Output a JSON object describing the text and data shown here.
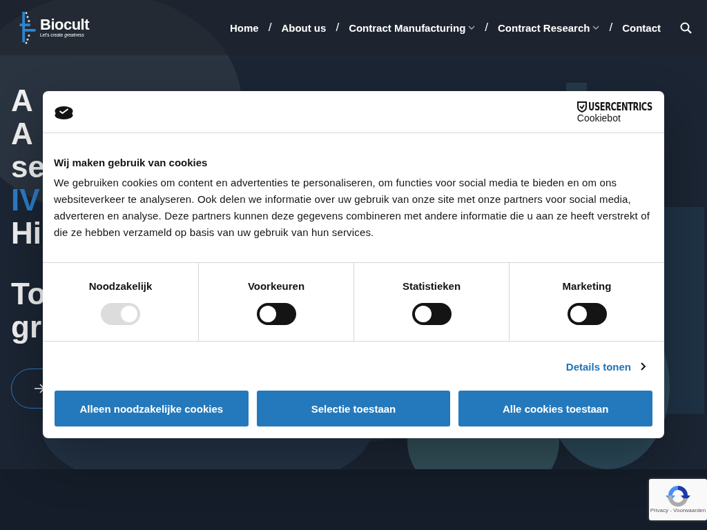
{
  "header": {
    "logo": {
      "name": "Biocult",
      "tagline": "Let's create *greatness*"
    },
    "nav": [
      {
        "kind": "link",
        "label": "Home",
        "dropdown": false
      },
      {
        "kind": "separator",
        "label": "/"
      },
      {
        "kind": "link",
        "label": "About us",
        "dropdown": false
      },
      {
        "kind": "separator",
        "label": "/"
      },
      {
        "kind": "link",
        "label": "Contract Manufacturing",
        "dropdown": true
      },
      {
        "kind": "separator",
        "label": "/"
      },
      {
        "kind": "link",
        "label": "Contract Research",
        "dropdown": true
      },
      {
        "kind": "separator",
        "label": "/"
      },
      {
        "kind": "link",
        "label": "Contact",
        "dropdown": false
      }
    ]
  },
  "hero": {
    "blocks": [
      [
        {
          "text": "A",
          "accent": false
        },
        {
          "text": "A",
          "accent": false
        },
        {
          "text": "se",
          "accent": false
        },
        {
          "text": "IV",
          "accent": true
        },
        {
          "text": "Hi",
          "accent": false
        }
      ],
      [
        {
          "text": "To",
          "accent": false
        },
        {
          "text": "gr",
          "accent": false
        }
      ]
    ]
  },
  "cookie_dialog": {
    "brand": {
      "name": "USERCENTRICS",
      "product": "Cookiebot"
    },
    "title": "Wij maken gebruik van cookies",
    "body": "We gebruiken cookies om content en advertenties te personaliseren, om functies voor social media te bieden en om ons websiteverkeer te analyseren. Ook delen we informatie over uw gebruik van onze site met onze partners voor social media, adverteren en analyse. Deze partners kunnen deze gegevens combineren met andere informatie die u aan ze heeft verstrekt of die ze hebben verzameld op basis van uw gebruik van hun services.",
    "categories": [
      {
        "label": "Noodzakelijk",
        "checked": true,
        "disabled": true
      },
      {
        "label": "Voorkeuren",
        "checked": false,
        "disabled": false
      },
      {
        "label": "Statistieken",
        "checked": false,
        "disabled": false
      },
      {
        "label": "Marketing",
        "checked": false,
        "disabled": false
      }
    ],
    "details_link": "Details tonen",
    "buttons": [
      "Alleen noodzakelijke cookies",
      "Selectie toestaan",
      "Alle cookies toestaan"
    ]
  },
  "recaptcha": {
    "links": "Privacy - Voorwaarden"
  }
}
